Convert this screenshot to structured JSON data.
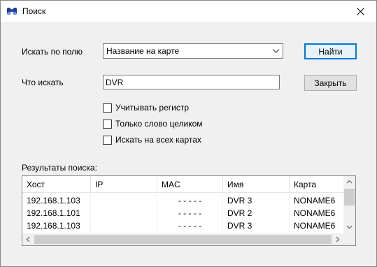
{
  "window": {
    "title": "Поиск"
  },
  "form": {
    "field_label": "Искать по полю",
    "field_value": "Название на карте",
    "find_button": "Найти",
    "query_label": "Что искать",
    "query_value": "DVR",
    "close_button": "Закрыть",
    "options": [
      "Учитывать регистр",
      "Только слово целиком",
      "Искать на всех картах"
    ]
  },
  "results": {
    "label": "Результаты поиска:",
    "columns": [
      "Хост",
      "IP",
      "MAC",
      "Имя",
      "Карта"
    ],
    "rows": [
      [
        "192.168.1.103",
        "",
        "- - - - -",
        "DVR 3",
        "NONAME6"
      ],
      [
        "192.168.1.101",
        "",
        "- - - - -",
        "DVR 2",
        "NONAME6"
      ],
      [
        "192.168.1.103",
        "",
        "- - - - -",
        "DVR 3",
        "NONAME6"
      ]
    ]
  },
  "icons": {
    "app": "binoculars-icon",
    "close": "close-icon",
    "dropdown": "chevron-down-icon"
  }
}
